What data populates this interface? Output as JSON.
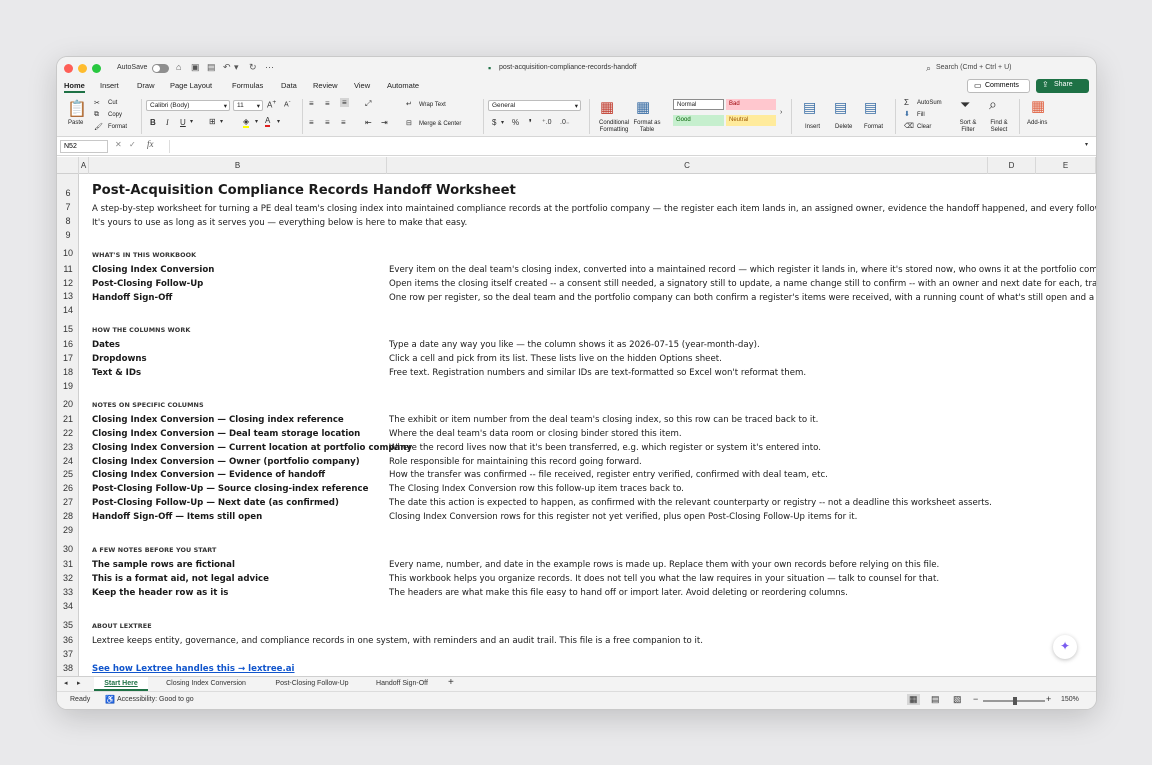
{
  "titlebar": {
    "autosave": "AutoSave",
    "doc_title": "post-acquisition-compliance-records-handoff",
    "search": "Search (Cmd + Ctrl + U)"
  },
  "tabs": [
    "Home",
    "Insert",
    "Draw",
    "Page Layout",
    "Formulas",
    "Data",
    "Review",
    "View",
    "Automate"
  ],
  "buttons": {
    "comments": "Comments",
    "share": "Share"
  },
  "ribbon": {
    "paste": "Paste",
    "cut": "Cut",
    "copy": "Copy",
    "format_painter": "Format",
    "font_name": "Calibri (Body)",
    "font_size": "11",
    "wrap_text": "Wrap Text",
    "merge_center": "Merge & Center",
    "number_format": "General",
    "conditional_formatting": "Conditional Formatting",
    "format_as_table": "Format as Table",
    "styles": {
      "normal": "Normal",
      "bad": "Bad",
      "good": "Good",
      "neutral": "Neutral"
    },
    "insert": "Insert",
    "delete": "Delete",
    "format": "Format",
    "autosum": "AutoSum",
    "fill": "Fill",
    "clear": "Clear",
    "sort_filter": "Sort & Filter",
    "find_select": "Find & Select",
    "add_ins": "Add-ins"
  },
  "formula_bar": {
    "name_box": "N52",
    "fx": "fx",
    "value": ""
  },
  "columns": [
    "A",
    "B",
    "C",
    "D",
    "E"
  ],
  "rows": {
    "numbers": [
      "6",
      "7",
      "8",
      "9",
      "10",
      "11",
      "12",
      "13",
      "14",
      "15",
      "16",
      "17",
      "18",
      "19",
      "20",
      "21",
      "22",
      "23",
      "24",
      "25",
      "26",
      "27",
      "28",
      "29",
      "30",
      "31",
      "32",
      "33",
      "34",
      "35",
      "36",
      "37",
      "38"
    ],
    "r6": "Post-Acquisition Compliance Records Handoff Worksheet",
    "r7": "A step-by-step worksheet for turning a PE deal team's closing index into maintained compliance records at the portfolio company — the register each item lands in, an assigned owner, evidence the handoff happened, and every follow-up item",
    "r8": "It's yours to use as long as it serves you — everything below is here to make that easy.",
    "r10": "WHAT'S IN THIS WORKBOOK",
    "r11_b": "Closing Index Conversion",
    "r11_c": "Every item on the deal team's closing index, converted into a maintained record — which register it lands in, where it's stored now, who owns it at the portfolio company",
    "r12_b": "Post-Closing Follow-Up",
    "r12_c": "Open items the closing itself created -- a consent still needed, a signatory still to update, a name change still to confirm -- with an owner and next date for each, tracked s",
    "r13_b": "Handoff Sign-Off",
    "r13_c": "One row per register, so the deal team and the portfolio company can both confirm a register's items were received, with a running count of what's still open and a place",
    "r15": "HOW THE COLUMNS WORK",
    "r16_b": "Dates",
    "r16_c": "Type a date any way you like — the column shows it as 2026-07-15 (year-month-day).",
    "r17_b": "Dropdowns",
    "r17_c": "Click a cell and pick from its list. These lists live on the hidden Options sheet.",
    "r18_b": "Text & IDs",
    "r18_c": "Free text. Registration numbers and similar IDs are text-formatted so Excel won't reformat them.",
    "r20": "NOTES ON SPECIFIC COLUMNS",
    "r21_b": "Closing Index Conversion — Closing index reference",
    "r21_c": "The exhibit or item number from the deal team's closing index, so this row can be traced back to it.",
    "r22_b": "Closing Index Conversion — Deal team storage location",
    "r22_c": "Where the deal team's data room or closing binder stored this item.",
    "r23_b": "Closing Index Conversion — Current location at portfolio company",
    "r23_c": "Where the record lives now that it's been transferred, e.g. which register or system it's entered into.",
    "r24_b": "Closing Index Conversion — Owner (portfolio company)",
    "r24_c": "Role responsible for maintaining this record going forward.",
    "r25_b": "Closing Index Conversion — Evidence of handoff",
    "r25_c": "How the transfer was confirmed -- file received, register entry verified, confirmed with deal team, etc.",
    "r26_b": "Post-Closing Follow-Up — Source closing-index reference",
    "r26_c": "The Closing Index Conversion row this follow-up item traces back to.",
    "r27_b": "Post-Closing Follow-Up — Next date (as confirmed)",
    "r27_c": "The date this action is expected to happen, as confirmed with the relevant counterparty or registry -- not a deadline this worksheet asserts.",
    "r28_b": "Handoff Sign-Off — Items still open",
    "r28_c": "Closing Index Conversion rows for this register not yet verified, plus open Post-Closing Follow-Up items for it.",
    "r30": "A FEW NOTES BEFORE YOU START",
    "r31_b": "The sample rows are fictional",
    "r31_c": "Every name, number, and date in the example rows is made up. Replace them with your own records before relying on this file.",
    "r32_b": "This is a format aid, not legal advice",
    "r32_c": "This workbook helps you organize records. It does not tell you what the law requires in your situation — talk to counsel for that.",
    "r33_b": "Keep the header row as it is",
    "r33_c": "The headers are what make this file easy to hand off or import later. Avoid deleting or reordering columns.",
    "r35": "ABOUT LEXTREE",
    "r36": "Lextree keeps entity, governance, and compliance records in one system, with reminders and an audit trail. This file is a free companion to it.",
    "r38": "See how Lextree handles this → lextree.ai"
  },
  "sheet_tabs": [
    "Start Here",
    "Closing Index Conversion",
    "Post-Closing Follow-Up",
    "Handoff Sign-Off"
  ],
  "status": {
    "ready": "Ready",
    "accessibility": "Accessibility: Good to go",
    "zoom": "150%"
  },
  "colors": {
    "accent": "#1e7145",
    "link": "#1155cc",
    "bad_bg": "#ffc7ce",
    "good_bg": "#c6efce",
    "neutral_bg": "#ffeb9c"
  }
}
